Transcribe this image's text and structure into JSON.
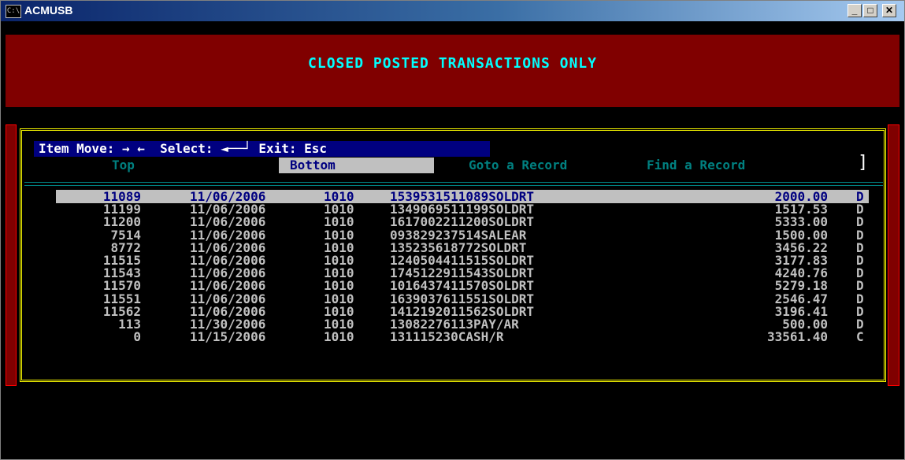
{
  "window": {
    "title": "ACMUSB",
    "icon_text": "C:\\",
    "buttons": {
      "minimize": "_",
      "maximize": "□",
      "close": "✕"
    }
  },
  "header": {
    "heading": "CLOSED POSTED TRANSACTIONS ONLY"
  },
  "hint_bar": {
    "text": "Item Move: → ←  Select: ◄──┘ Exit: Esc"
  },
  "menu": {
    "top": "Top",
    "bottom": "Bottom",
    "goto": "Goto a Record",
    "find": "Find a Record"
  },
  "scroll_marker": "]",
  "selected_row_index": 0,
  "transactions": [
    {
      "id": "11089",
      "date": "11/06/2006",
      "account": "1010",
      "reference": "1539531511089SOLDRT",
      "amount": "2000.00",
      "type": "D"
    },
    {
      "id": "11199",
      "date": "11/06/2006",
      "account": "1010",
      "reference": "1349069511199SOLDRT",
      "amount": "1517.53",
      "type": "D"
    },
    {
      "id": "11200",
      "date": "11/06/2006",
      "account": "1010",
      "reference": "1617002211200SOLDRT",
      "amount": "5333.00",
      "type": "D"
    },
    {
      "id": "7514",
      "date": "11/06/2006",
      "account": "1010",
      "reference": "093829237514SALEAR",
      "amount": "1500.00",
      "type": "D"
    },
    {
      "id": "8772",
      "date": "11/06/2006",
      "account": "1010",
      "reference": "135235618772SOLDRT",
      "amount": "3456.22",
      "type": "D"
    },
    {
      "id": "11515",
      "date": "11/06/2006",
      "account": "1010",
      "reference": "1240504411515SOLDRT",
      "amount": "3177.83",
      "type": "D"
    },
    {
      "id": "11543",
      "date": "11/06/2006",
      "account": "1010",
      "reference": "1745122911543SOLDRT",
      "amount": "4240.76",
      "type": "D"
    },
    {
      "id": "11570",
      "date": "11/06/2006",
      "account": "1010",
      "reference": "1016437411570SOLDRT",
      "amount": "5279.18",
      "type": "D"
    },
    {
      "id": "11551",
      "date": "11/06/2006",
      "account": "1010",
      "reference": "1639037611551SOLDRT",
      "amount": "2546.47",
      "type": "D"
    },
    {
      "id": "11562",
      "date": "11/06/2006",
      "account": "1010",
      "reference": "1412192011562SOLDRT",
      "amount": "3196.41",
      "type": "D"
    },
    {
      "id": "113",
      "date": "11/30/2006",
      "account": "1010",
      "reference": "13082276113PAY/AR",
      "amount": "500.00",
      "type": "D"
    },
    {
      "id": "0",
      "date": "11/15/2006",
      "account": "1010",
      "reference": "131115230CASH/R",
      "amount": "33561.40",
      "type": "C"
    }
  ]
}
